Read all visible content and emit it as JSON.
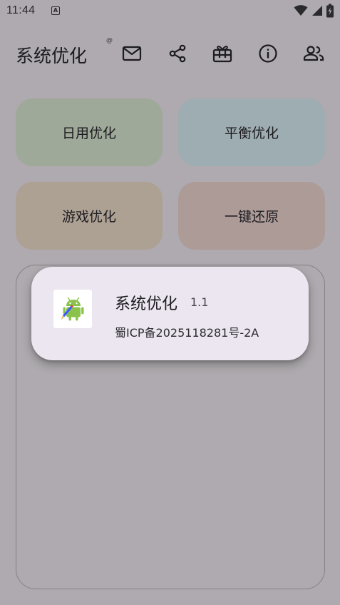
{
  "status_bar": {
    "time": "11:44",
    "notification_letter": "A"
  },
  "app_bar": {
    "title": "系统优化",
    "title_mark": "@",
    "actions": [
      "mail-icon",
      "share-icon",
      "gift-icon",
      "info-icon",
      "group-icon"
    ]
  },
  "tiles": [
    {
      "label": "日用优化",
      "color": "#9fa99a"
    },
    {
      "label": "平衡优化",
      "color": "#9eadb1"
    },
    {
      "label": "游戏优化",
      "color": "#ada193"
    },
    {
      "label": "一键还原",
      "color": "#ad9b98"
    }
  ],
  "dialog": {
    "app_name": "系统优化",
    "version": "1.1",
    "icp": "蜀ICP备2025118281号-2A"
  },
  "colors": {
    "background": "#aeaaaf",
    "dialog_surface": "#ebe6ef",
    "outline": "#858086"
  }
}
